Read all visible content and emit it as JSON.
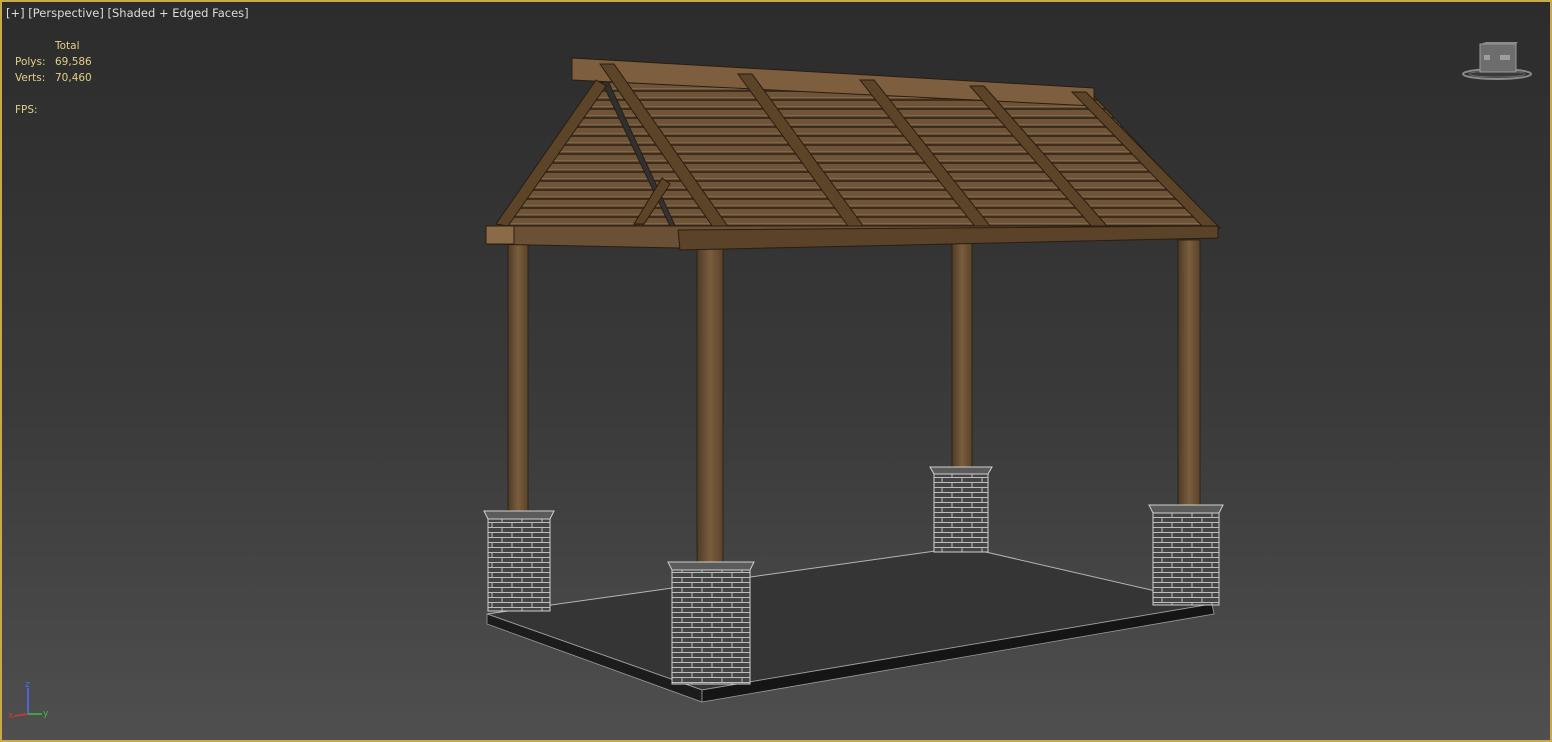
{
  "viewport": {
    "label_plus": "[+]",
    "label_view": "[Perspective]",
    "label_shading": "[Shaded + Edged Faces]"
  },
  "stats": {
    "header": "Total",
    "polys_label": "Polys:",
    "polys_value": "69,586",
    "verts_label": "Verts:",
    "verts_value": "70,460",
    "fps_label": "FPS:"
  },
  "viewcube": {
    "icon": "viewcube-icon"
  },
  "axis": {
    "z": "z",
    "x": "x",
    "y": "y",
    "colors": {
      "x": "#d23a3a",
      "y": "#3fbf3f",
      "z": "#4a6cff"
    }
  },
  "colors": {
    "border": "#c9a94a",
    "wood": "#6b5236",
    "wood_light": "#8a6b48",
    "brick": "#4a4a4a",
    "floor": "#3a3a3a",
    "stats_text": "#e3cf86"
  }
}
